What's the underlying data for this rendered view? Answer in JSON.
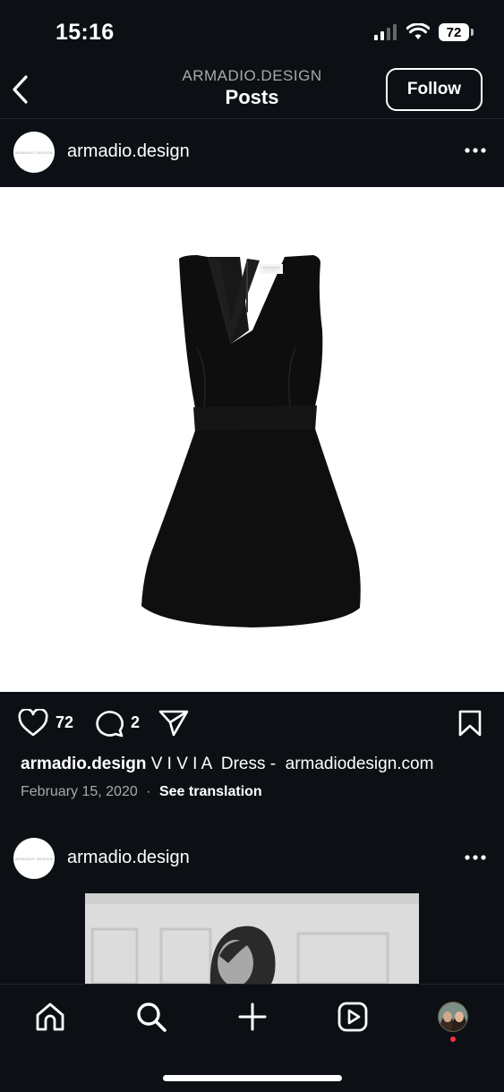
{
  "status_bar": {
    "time": "15:16",
    "battery": "72"
  },
  "header": {
    "account": "ARMADIO.DESIGN",
    "title": "Posts",
    "follow_label": "Follow"
  },
  "posts": [
    {
      "username": "armadio.design",
      "avatar_text": "ARMADIO DESIGN",
      "likes": "72",
      "comments": "2",
      "caption_user": "armadio.design",
      "caption_text": " V I V I A  Dress -  armadiodesign.com",
      "date": "February 15, 2020",
      "separator": "·",
      "see_translation": "See translation"
    },
    {
      "username": "armadio.design",
      "avatar_text": "ARMADIO DESIGN"
    }
  ],
  "bottom_nav": [
    "home-icon",
    "search-icon",
    "create-icon",
    "reels-icon",
    "profile-avatar"
  ],
  "colors": {
    "background": "#0c1014",
    "text": "#ffffff",
    "muted": "#a8a8a8",
    "notification_dot": "#ff3040"
  }
}
